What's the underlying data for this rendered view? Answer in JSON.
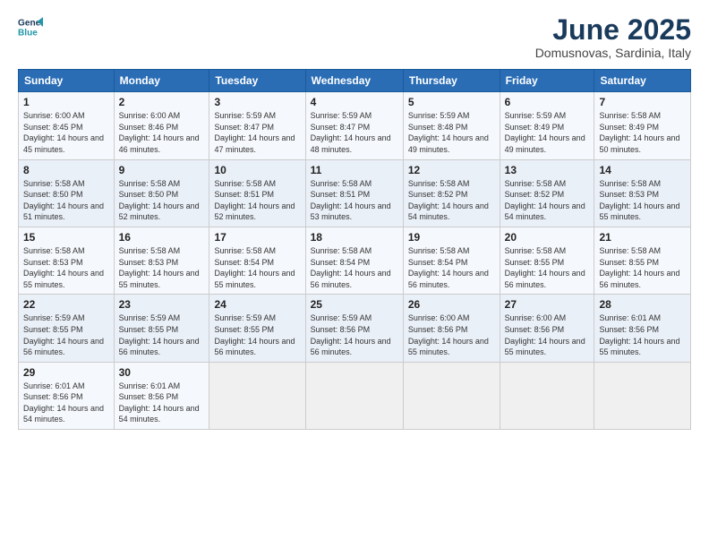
{
  "header": {
    "logo_line1": "General",
    "logo_line2": "Blue",
    "month": "June 2025",
    "location": "Domusnovas, Sardinia, Italy"
  },
  "weekdays": [
    "Sunday",
    "Monday",
    "Tuesday",
    "Wednesday",
    "Thursday",
    "Friday",
    "Saturday"
  ],
  "weeks": [
    [
      {
        "day": "1",
        "sunrise": "Sunrise: 6:00 AM",
        "sunset": "Sunset: 8:45 PM",
        "daylight": "Daylight: 14 hours and 45 minutes."
      },
      {
        "day": "2",
        "sunrise": "Sunrise: 6:00 AM",
        "sunset": "Sunset: 8:46 PM",
        "daylight": "Daylight: 14 hours and 46 minutes."
      },
      {
        "day": "3",
        "sunrise": "Sunrise: 5:59 AM",
        "sunset": "Sunset: 8:47 PM",
        "daylight": "Daylight: 14 hours and 47 minutes."
      },
      {
        "day": "4",
        "sunrise": "Sunrise: 5:59 AM",
        "sunset": "Sunset: 8:47 PM",
        "daylight": "Daylight: 14 hours and 48 minutes."
      },
      {
        "day": "5",
        "sunrise": "Sunrise: 5:59 AM",
        "sunset": "Sunset: 8:48 PM",
        "daylight": "Daylight: 14 hours and 49 minutes."
      },
      {
        "day": "6",
        "sunrise": "Sunrise: 5:59 AM",
        "sunset": "Sunset: 8:49 PM",
        "daylight": "Daylight: 14 hours and 49 minutes."
      },
      {
        "day": "7",
        "sunrise": "Sunrise: 5:58 AM",
        "sunset": "Sunset: 8:49 PM",
        "daylight": "Daylight: 14 hours and 50 minutes."
      }
    ],
    [
      {
        "day": "8",
        "sunrise": "Sunrise: 5:58 AM",
        "sunset": "Sunset: 8:50 PM",
        "daylight": "Daylight: 14 hours and 51 minutes."
      },
      {
        "day": "9",
        "sunrise": "Sunrise: 5:58 AM",
        "sunset": "Sunset: 8:50 PM",
        "daylight": "Daylight: 14 hours and 52 minutes."
      },
      {
        "day": "10",
        "sunrise": "Sunrise: 5:58 AM",
        "sunset": "Sunset: 8:51 PM",
        "daylight": "Daylight: 14 hours and 52 minutes."
      },
      {
        "day": "11",
        "sunrise": "Sunrise: 5:58 AM",
        "sunset": "Sunset: 8:51 PM",
        "daylight": "Daylight: 14 hours and 53 minutes."
      },
      {
        "day": "12",
        "sunrise": "Sunrise: 5:58 AM",
        "sunset": "Sunset: 8:52 PM",
        "daylight": "Daylight: 14 hours and 54 minutes."
      },
      {
        "day": "13",
        "sunrise": "Sunrise: 5:58 AM",
        "sunset": "Sunset: 8:52 PM",
        "daylight": "Daylight: 14 hours and 54 minutes."
      },
      {
        "day": "14",
        "sunrise": "Sunrise: 5:58 AM",
        "sunset": "Sunset: 8:53 PM",
        "daylight": "Daylight: 14 hours and 55 minutes."
      }
    ],
    [
      {
        "day": "15",
        "sunrise": "Sunrise: 5:58 AM",
        "sunset": "Sunset: 8:53 PM",
        "daylight": "Daylight: 14 hours and 55 minutes."
      },
      {
        "day": "16",
        "sunrise": "Sunrise: 5:58 AM",
        "sunset": "Sunset: 8:53 PM",
        "daylight": "Daylight: 14 hours and 55 minutes."
      },
      {
        "day": "17",
        "sunrise": "Sunrise: 5:58 AM",
        "sunset": "Sunset: 8:54 PM",
        "daylight": "Daylight: 14 hours and 55 minutes."
      },
      {
        "day": "18",
        "sunrise": "Sunrise: 5:58 AM",
        "sunset": "Sunset: 8:54 PM",
        "daylight": "Daylight: 14 hours and 56 minutes."
      },
      {
        "day": "19",
        "sunrise": "Sunrise: 5:58 AM",
        "sunset": "Sunset: 8:54 PM",
        "daylight": "Daylight: 14 hours and 56 minutes."
      },
      {
        "day": "20",
        "sunrise": "Sunrise: 5:58 AM",
        "sunset": "Sunset: 8:55 PM",
        "daylight": "Daylight: 14 hours and 56 minutes."
      },
      {
        "day": "21",
        "sunrise": "Sunrise: 5:58 AM",
        "sunset": "Sunset: 8:55 PM",
        "daylight": "Daylight: 14 hours and 56 minutes."
      }
    ],
    [
      {
        "day": "22",
        "sunrise": "Sunrise: 5:59 AM",
        "sunset": "Sunset: 8:55 PM",
        "daylight": "Daylight: 14 hours and 56 minutes."
      },
      {
        "day": "23",
        "sunrise": "Sunrise: 5:59 AM",
        "sunset": "Sunset: 8:55 PM",
        "daylight": "Daylight: 14 hours and 56 minutes."
      },
      {
        "day": "24",
        "sunrise": "Sunrise: 5:59 AM",
        "sunset": "Sunset: 8:55 PM",
        "daylight": "Daylight: 14 hours and 56 minutes."
      },
      {
        "day": "25",
        "sunrise": "Sunrise: 5:59 AM",
        "sunset": "Sunset: 8:56 PM",
        "daylight": "Daylight: 14 hours and 56 minutes."
      },
      {
        "day": "26",
        "sunrise": "Sunrise: 6:00 AM",
        "sunset": "Sunset: 8:56 PM",
        "daylight": "Daylight: 14 hours and 55 minutes."
      },
      {
        "day": "27",
        "sunrise": "Sunrise: 6:00 AM",
        "sunset": "Sunset: 8:56 PM",
        "daylight": "Daylight: 14 hours and 55 minutes."
      },
      {
        "day": "28",
        "sunrise": "Sunrise: 6:01 AM",
        "sunset": "Sunset: 8:56 PM",
        "daylight": "Daylight: 14 hours and 55 minutes."
      }
    ],
    [
      {
        "day": "29",
        "sunrise": "Sunrise: 6:01 AM",
        "sunset": "Sunset: 8:56 PM",
        "daylight": "Daylight: 14 hours and 54 minutes."
      },
      {
        "day": "30",
        "sunrise": "Sunrise: 6:01 AM",
        "sunset": "Sunset: 8:56 PM",
        "daylight": "Daylight: 14 hours and 54 minutes."
      },
      null,
      null,
      null,
      null,
      null
    ]
  ]
}
